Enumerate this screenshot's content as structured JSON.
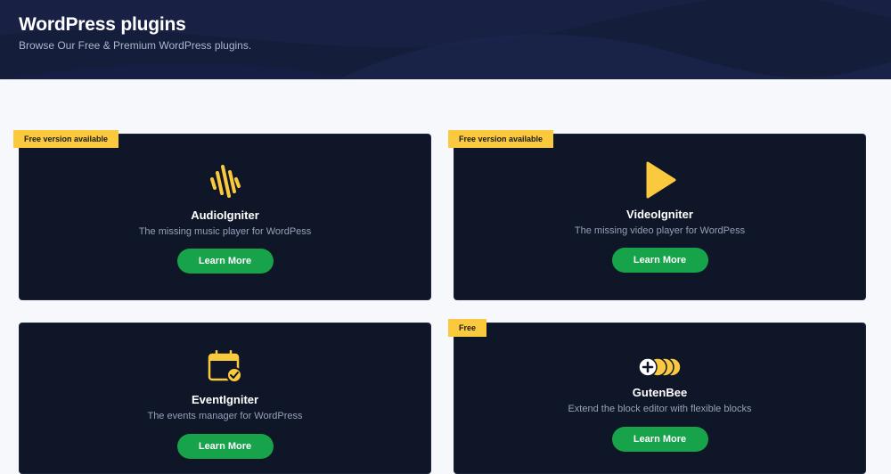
{
  "header": {
    "title": "WordPress plugins",
    "subtitle": "Browse Our Free & Premium WordPress plugins."
  },
  "plugins": [
    {
      "badge": "Free version available",
      "name": "AudioIgniter",
      "description": "The missing music player for WordPess",
      "button": "Learn More",
      "icon": "audio-wave-icon"
    },
    {
      "badge": "Free version available",
      "name": "VideoIgniter",
      "description": "The missing video player for WordPess",
      "button": "Learn More",
      "icon": "play-icon"
    },
    {
      "badge": "",
      "name": "EventIgniter",
      "description": "The events manager for WordPress",
      "button": "Learn More",
      "icon": "calendar-check-icon"
    },
    {
      "badge": "Free",
      "name": "GutenBee",
      "description": "Extend the block editor with flexible blocks",
      "button": "Learn More",
      "icon": "add-blocks-icon"
    }
  ],
  "colors": {
    "accent": "#fbc93d",
    "button": "#16a34a",
    "card": "#0e1628",
    "header": "#141d3a"
  }
}
